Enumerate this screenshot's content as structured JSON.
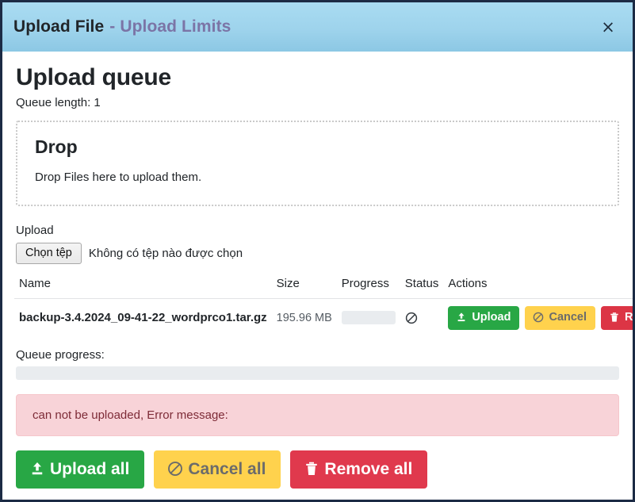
{
  "titlebar": {
    "title": "Upload File",
    "separator": "-",
    "subtitle": "Upload Limits",
    "close_icon": "×"
  },
  "main": {
    "page_title": "Upload queue",
    "queue_length": "Queue length: 1",
    "dropzone": {
      "title": "Drop",
      "text": "Drop Files here to upload them."
    },
    "upload": {
      "label": "Upload",
      "choose_button": "Chọn tệp",
      "no_file_text": "Không có tệp nào được chọn"
    },
    "table": {
      "headers": [
        "Name",
        "Size",
        "Progress",
        "Status",
        "Actions"
      ],
      "rows": [
        {
          "name": "backup-3.4.2024_09-41-22_wordprco1.tar.gz",
          "size": "195.96 MB",
          "progress": 0,
          "status_icon": "ban-icon",
          "actions": {
            "upload": "Upload",
            "cancel": "Cancel",
            "remove": "Remove"
          }
        }
      ]
    },
    "queue_progress": {
      "label": "Queue progress:",
      "value": 0
    },
    "error": {
      "message": "can not be uploaded, Error message:"
    },
    "footer": {
      "upload_all": "Upload all",
      "cancel_all": "Cancel all",
      "remove_all": "Remove all"
    }
  },
  "colors": {
    "header_top": "#a9dcf2",
    "header_bottom": "#8cc8e4",
    "success": "#28a745",
    "warning": "#ffd24d",
    "danger": "#dc3545",
    "alert_bg": "#f8d3d8",
    "alert_text": "#7d2b37",
    "subtitle": "#7b74a6"
  }
}
